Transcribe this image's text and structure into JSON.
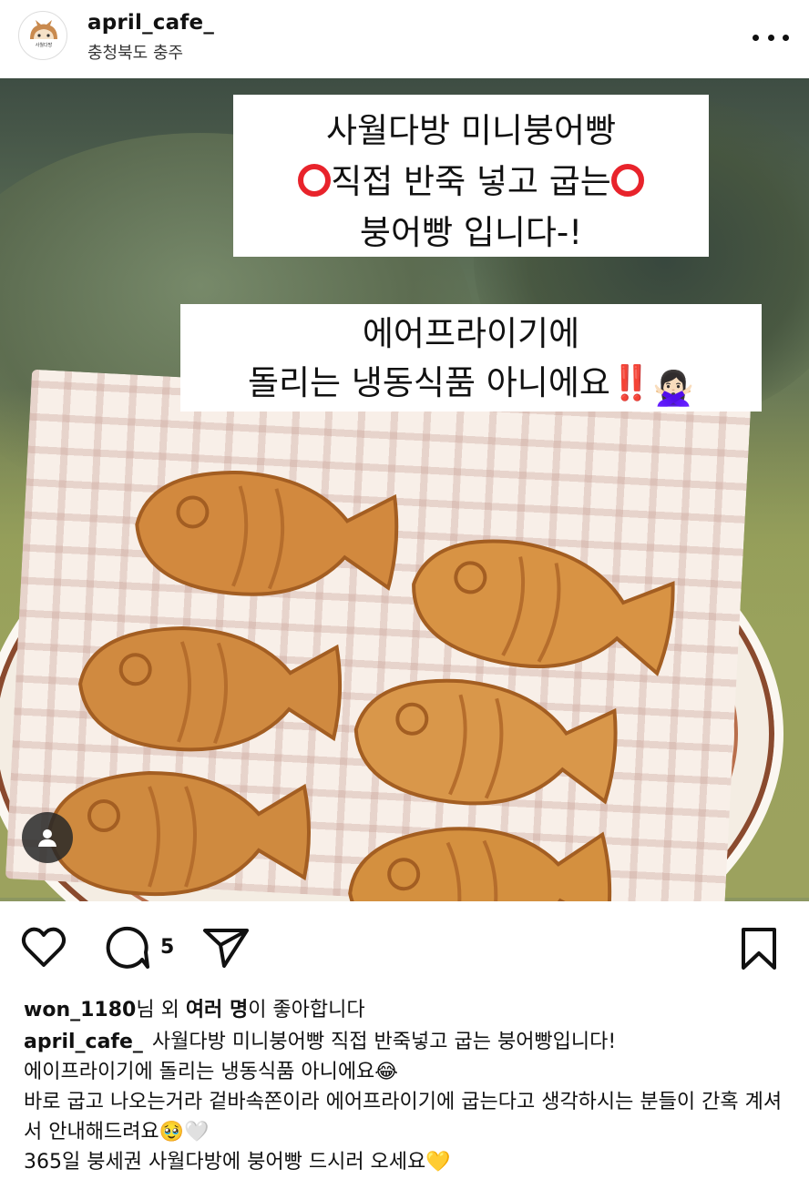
{
  "header": {
    "username": "april_cafe_",
    "location": "충청북도 충주"
  },
  "photo": {
    "caption_box_1": {
      "line1": "사월다방 미니붕어빵",
      "line2": "직접 반죽 넣고 굽는",
      "line3": "붕어빵 입니다-!"
    },
    "caption_box_2": {
      "line1": "에어프라이기에",
      "line2": "돌리는 냉동식품 아니에요",
      "exclaim": "‼️",
      "emoji": "🙅🏻‍♀️"
    }
  },
  "actions": {
    "comment_count": "5"
  },
  "likes": {
    "user": "won_1180",
    "middle": "님 외 ",
    "others": "여러 명",
    "suffix": "이 좋아합니다"
  },
  "caption": {
    "author": "april_cafe_",
    "line1": "사월다방 미니붕어빵 직접 반죽넣고 굽는 붕어빵입니다!",
    "line2": "에이프라이기에 돌리는 냉동식품 아니에요😂",
    "line3": "바로 굽고 나오는거라 겉바속쫀이라 에어프라이기에 굽는다고 생각하시는 분들이 간혹 계셔서 안내해드려요🥹🤍",
    "line4": "365일 붕세권 사월다방에 붕어빵 드시러 오세요💛"
  },
  "colors": {
    "red_circle": "#e8232b",
    "text": "#111111"
  }
}
